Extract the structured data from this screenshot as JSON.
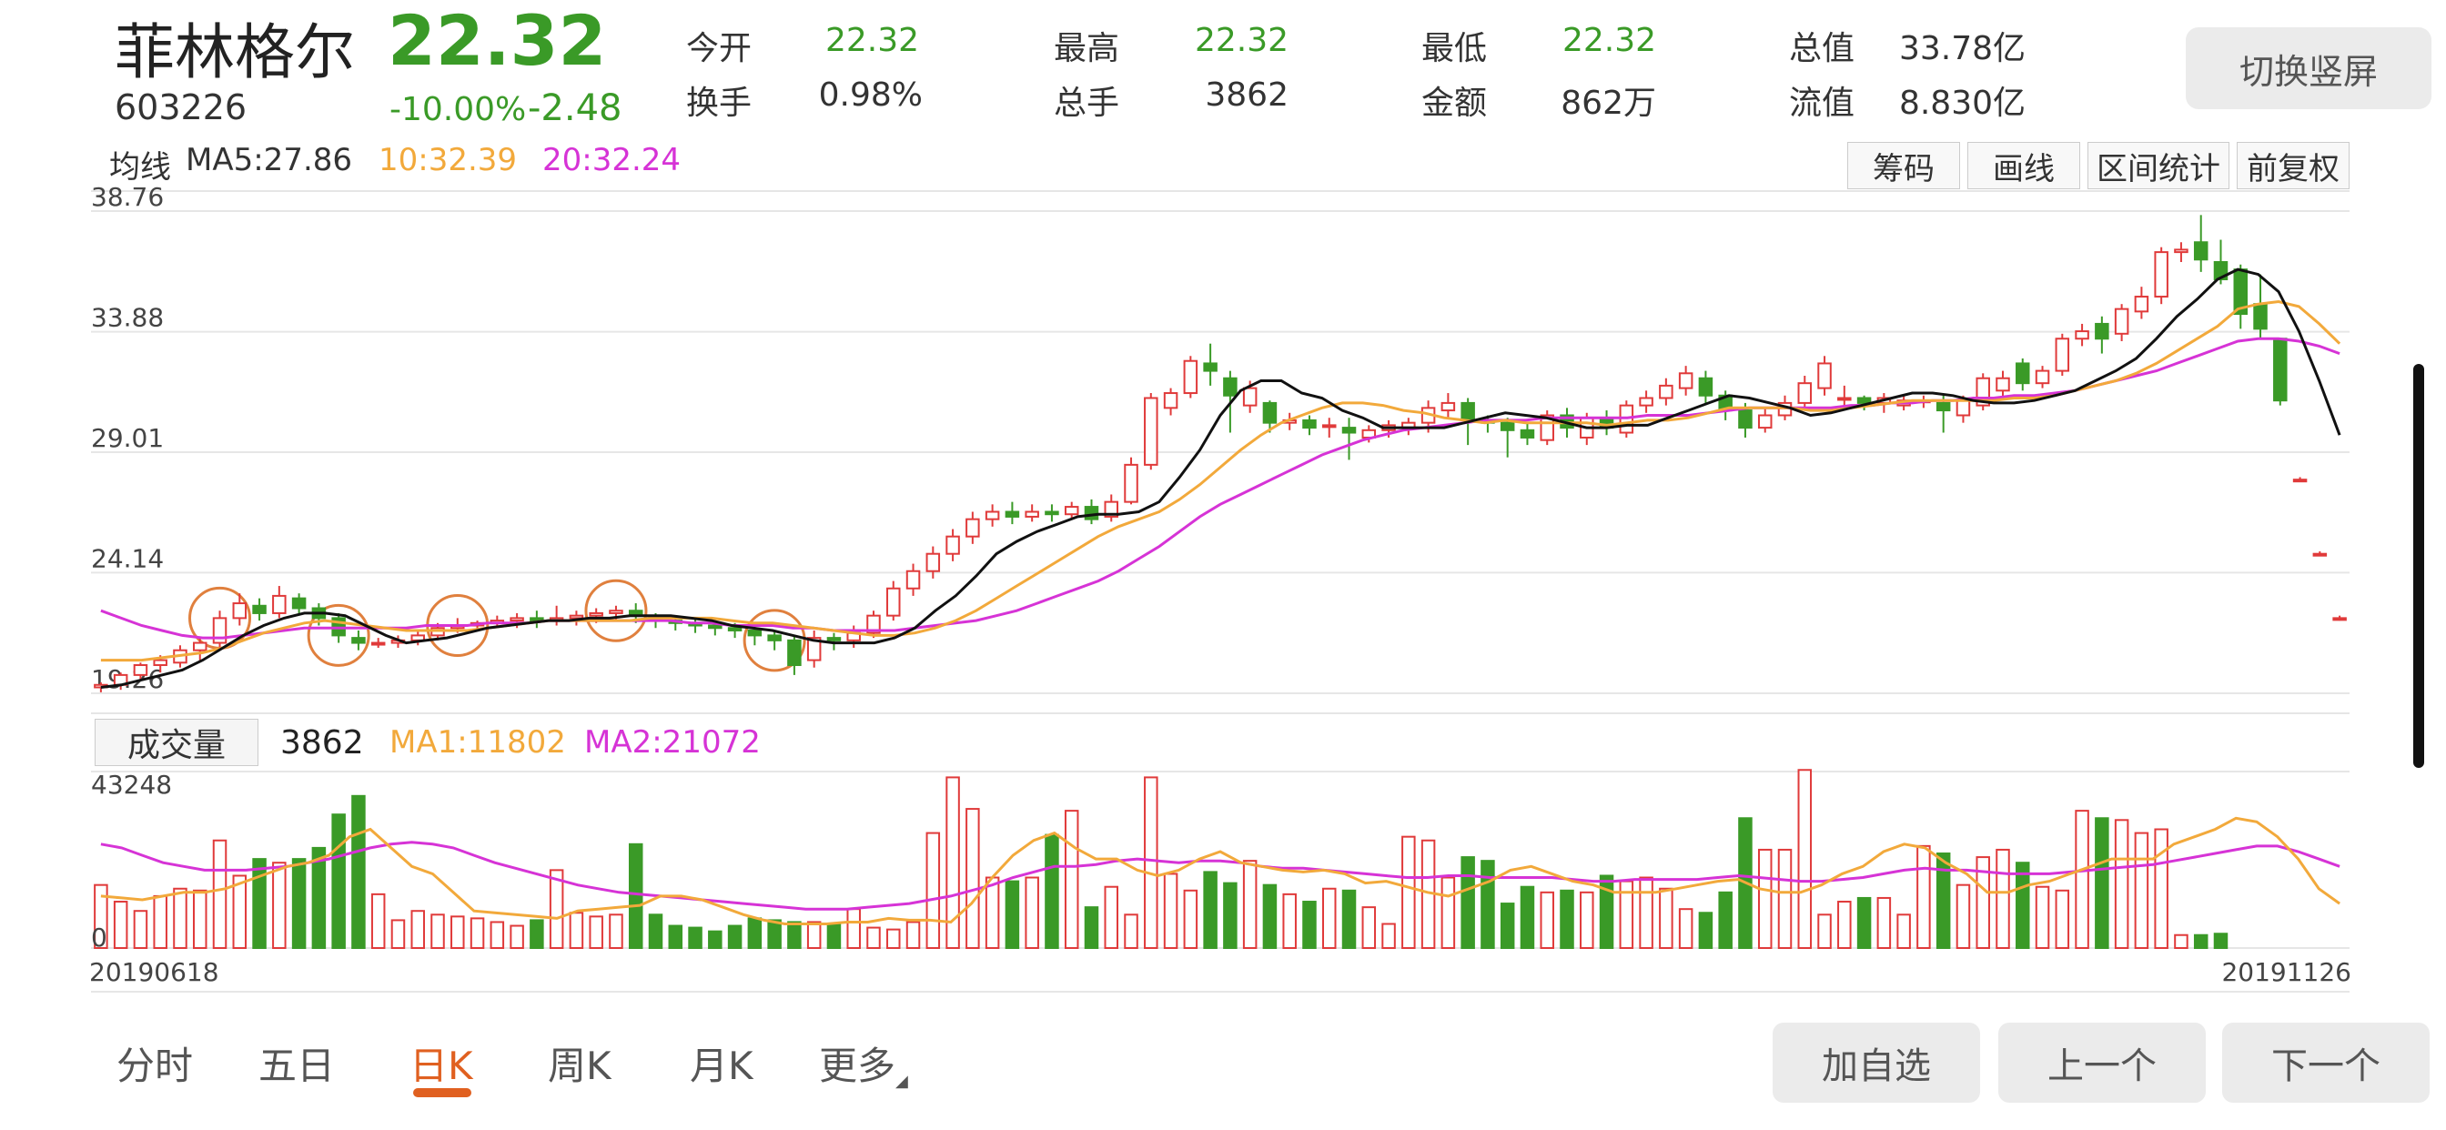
{
  "header": {
    "name": "菲林格尔",
    "price": "22.32",
    "code": "603226",
    "change_pct": "-10.00%",
    "change_amt": "-2.48",
    "quotes": [
      {
        "label": "今开",
        "value": "22.32",
        "color": "#3a9a27"
      },
      {
        "label": "最高",
        "value": "22.32",
        "color": "#3a9a27"
      },
      {
        "label": "最低",
        "value": "22.32",
        "color": "#3a9a27"
      },
      {
        "label": "总值",
        "value": "33.78亿",
        "color": "#333333"
      },
      {
        "label": "换手",
        "value": "0.98%",
        "color": "#333333"
      },
      {
        "label": "总手",
        "value": "3862",
        "color": "#333333"
      },
      {
        "label": "金额",
        "value": "862万",
        "color": "#333333"
      },
      {
        "label": "流值",
        "value": "8.830亿",
        "color": "#333333"
      }
    ],
    "switch_label": "切换竖屏"
  },
  "ma_bar": {
    "prefix": "均线",
    "ma5": "MA5:27.86",
    "ma10": "10:32.39",
    "ma20": "20:32.24"
  },
  "tools": [
    "筹码",
    "画线",
    "区间统计",
    "前复权"
  ],
  "volume_bar": {
    "label": "成交量",
    "value": "3862",
    "ma1": "MA1:11802",
    "ma2": "MA2:21072"
  },
  "bottom_tabs": [
    {
      "label": "分时",
      "active": false
    },
    {
      "label": "五日",
      "active": false
    },
    {
      "label": "日K",
      "active": true
    },
    {
      "label": "周K",
      "active": false
    },
    {
      "label": "月K",
      "active": false
    },
    {
      "label": "更多",
      "active": false
    }
  ],
  "bottom_buttons": [
    "加自选",
    "上一个",
    "下一个"
  ],
  "colors": {
    "up": "#e03a3a",
    "down": "#3a9a27",
    "ma5": "#111111",
    "ma10": "#f2a93b",
    "ma20": "#d633d6",
    "accent": "#e06020"
  },
  "chart_data": {
    "type": "candlestick",
    "x_start": "20190618",
    "x_end": "20191126",
    "y_ticks": [
      "38.76",
      "33.88",
      "29.01",
      "24.14",
      "19.26"
    ],
    "ylim": [
      19.26,
      38.76
    ],
    "volume_ymax": 43248,
    "volume_ticks": [
      "43248",
      "0"
    ],
    "candles": [
      [
        19.5,
        19.6,
        19.3,
        19.7
      ],
      [
        19.6,
        20.0,
        19.4,
        20.1
      ],
      [
        20.0,
        20.4,
        19.8,
        20.5
      ],
      [
        20.4,
        20.6,
        20.1,
        20.8
      ],
      [
        20.5,
        21.0,
        20.3,
        21.2
      ],
      [
        21.0,
        21.3,
        20.6,
        21.5
      ],
      [
        21.3,
        22.3,
        21.1,
        22.6
      ],
      [
        22.3,
        22.9,
        22.0,
        23.3
      ],
      [
        22.8,
        22.5,
        22.2,
        23.1
      ],
      [
        22.5,
        23.2,
        22.3,
        23.6
      ],
      [
        23.1,
        22.7,
        22.5,
        23.3
      ],
      [
        22.7,
        22.3,
        22.0,
        22.9
      ],
      [
        22.3,
        21.6,
        21.3,
        22.5
      ],
      [
        21.5,
        21.3,
        21.0,
        21.8
      ],
      [
        21.3,
        21.3,
        21.1,
        21.5
      ],
      [
        21.3,
        21.4,
        21.1,
        21.6
      ],
      [
        21.4,
        21.6,
        21.2,
        21.8
      ],
      [
        21.6,
        21.9,
        21.4,
        22.1
      ],
      [
        21.9,
        22.0,
        21.7,
        22.3
      ],
      [
        22.0,
        22.1,
        21.8,
        22.2
      ],
      [
        22.1,
        22.2,
        21.9,
        22.4
      ],
      [
        22.2,
        22.3,
        21.9,
        22.5
      ],
      [
        22.3,
        22.2,
        21.9,
        22.6
      ],
      [
        22.2,
        22.3,
        22.0,
        22.8
      ],
      [
        22.3,
        22.4,
        22.0,
        22.6
      ],
      [
        22.4,
        22.5,
        22.1,
        22.7
      ],
      [
        22.5,
        22.6,
        22.2,
        22.8
      ],
      [
        22.6,
        22.4,
        22.1,
        22.9
      ],
      [
        22.4,
        22.2,
        21.9,
        22.5
      ],
      [
        22.2,
        22.1,
        21.8,
        22.4
      ],
      [
        22.1,
        22.0,
        21.7,
        22.3
      ],
      [
        22.0,
        21.9,
        21.6,
        22.2
      ],
      [
        21.9,
        21.8,
        21.5,
        22.1
      ],
      [
        21.8,
        21.6,
        21.2,
        22.0
      ],
      [
        21.6,
        21.4,
        21.0,
        21.8
      ],
      [
        21.4,
        20.4,
        20.0,
        21.6
      ],
      [
        20.6,
        21.5,
        20.3,
        21.8
      ],
      [
        21.5,
        21.4,
        21.0,
        21.7
      ],
      [
        21.4,
        21.7,
        21.1,
        22.0
      ],
      [
        21.7,
        22.4,
        21.5,
        22.6
      ],
      [
        22.4,
        23.5,
        22.2,
        23.8
      ],
      [
        23.5,
        24.2,
        23.2,
        24.5
      ],
      [
        24.2,
        24.9,
        23.9,
        25.2
      ],
      [
        24.9,
        25.6,
        24.6,
        25.9
      ],
      [
        25.6,
        26.3,
        25.3,
        26.6
      ],
      [
        26.3,
        26.6,
        26.0,
        26.9
      ],
      [
        26.6,
        26.4,
        26.1,
        27.0
      ],
      [
        26.4,
        26.6,
        26.2,
        26.9
      ],
      [
        26.6,
        26.5,
        26.2,
        26.9
      ],
      [
        26.5,
        26.8,
        26.3,
        27.0
      ],
      [
        26.8,
        26.3,
        26.1,
        27.1
      ],
      [
        26.4,
        27.0,
        26.2,
        27.3
      ],
      [
        27.0,
        28.5,
        26.9,
        28.8
      ],
      [
        28.5,
        31.2,
        28.3,
        31.4
      ],
      [
        30.8,
        31.4,
        30.5,
        31.6
      ],
      [
        31.4,
        32.7,
        31.2,
        32.9
      ],
      [
        32.6,
        32.3,
        31.7,
        33.4
      ],
      [
        32.0,
        31.3,
        29.8,
        32.3
      ],
      [
        30.9,
        31.6,
        30.6,
        31.9
      ],
      [
        31.0,
        30.2,
        29.8,
        31.1
      ],
      [
        30.2,
        30.3,
        29.9,
        30.6
      ],
      [
        30.3,
        30.0,
        29.7,
        30.5
      ],
      [
        30.1,
        30.1,
        29.6,
        30.4
      ],
      [
        30.0,
        29.8,
        28.7,
        30.4
      ],
      [
        29.6,
        29.9,
        29.4,
        30.1
      ],
      [
        29.9,
        30.1,
        29.6,
        30.3
      ],
      [
        30.0,
        30.2,
        29.7,
        30.4
      ],
      [
        30.2,
        30.8,
        29.8,
        31.1
      ],
      [
        30.7,
        31.0,
        30.4,
        31.4
      ],
      [
        31.0,
        30.3,
        29.3,
        31.2
      ],
      [
        30.3,
        30.2,
        29.8,
        30.5
      ],
      [
        30.2,
        29.9,
        28.8,
        30.4
      ],
      [
        29.9,
        29.6,
        29.3,
        30.2
      ],
      [
        29.5,
        30.5,
        29.3,
        30.7
      ],
      [
        30.5,
        30.0,
        29.6,
        30.8
      ],
      [
        29.6,
        30.4,
        29.3,
        30.6
      ],
      [
        30.4,
        30.0,
        29.7,
        30.7
      ],
      [
        29.8,
        30.9,
        29.6,
        31.1
      ],
      [
        30.9,
        31.2,
        30.6,
        31.5
      ],
      [
        31.2,
        31.7,
        30.9,
        32.0
      ],
      [
        31.6,
        32.2,
        31.3,
        32.5
      ],
      [
        32.0,
        31.3,
        31.0,
        32.3
      ],
      [
        31.3,
        30.7,
        30.3,
        31.5
      ],
      [
        30.7,
        30.0,
        29.6,
        31.0
      ],
      [
        30.0,
        30.5,
        29.8,
        30.8
      ],
      [
        30.5,
        31.0,
        30.3,
        31.3
      ],
      [
        31.0,
        31.8,
        30.7,
        32.1
      ],
      [
        31.6,
        32.6,
        31.3,
        32.9
      ],
      [
        31.2,
        31.2,
        30.9,
        31.7
      ],
      [
        31.2,
        31.0,
        30.7,
        31.3
      ],
      [
        31.0,
        31.2,
        30.6,
        31.4
      ],
      [
        30.9,
        31.1,
        30.7,
        31.3
      ],
      [
        31.1,
        31.1,
        30.8,
        31.3
      ],
      [
        31.0,
        30.7,
        29.8,
        31.3
      ],
      [
        30.5,
        31.1,
        30.2,
        31.3
      ],
      [
        30.9,
        32.0,
        30.7,
        32.2
      ],
      [
        31.5,
        32.0,
        31.2,
        32.3
      ],
      [
        32.6,
        31.8,
        31.5,
        32.8
      ],
      [
        31.8,
        32.3,
        31.6,
        32.5
      ],
      [
        32.3,
        33.6,
        32.1,
        33.8
      ],
      [
        33.6,
        33.9,
        33.3,
        34.2
      ],
      [
        34.2,
        33.6,
        33.0,
        34.5
      ],
      [
        33.8,
        34.8,
        33.5,
        35.0
      ],
      [
        34.7,
        35.3,
        34.4,
        35.7
      ],
      [
        35.3,
        37.1,
        35.0,
        37.3
      ],
      [
        37.1,
        37.2,
        36.7,
        37.5
      ],
      [
        37.5,
        36.8,
        36.3,
        38.6
      ],
      [
        36.7,
        36.0,
        35.8,
        37.6
      ],
      [
        36.4,
        34.6,
        34.0,
        36.6
      ],
      [
        35.0,
        34.0,
        33.6,
        36.2
      ],
      [
        33.6,
        31.1,
        30.9,
        33.6
      ],
      [
        27.9,
        27.9,
        27.8,
        28.0
      ],
      [
        24.9,
        24.9,
        24.8,
        25.0
      ],
      [
        22.3,
        22.3,
        22.2,
        22.4
      ]
    ],
    "volumes": [
      17000,
      12500,
      10000,
      14000,
      16000,
      15500,
      29000,
      19500,
      24000,
      23000,
      24000,
      27000,
      36000,
      41000,
      14500,
      7500,
      10000,
      9000,
      8500,
      8000,
      7000,
      6000,
      7500,
      21000,
      9500,
      8500,
      9000,
      28000,
      9000,
      6000,
      5500,
      4500,
      6000,
      8000,
      7500,
      7000,
      7000,
      6500,
      10500,
      5500,
      5000,
      7000,
      31000,
      46000,
      37500,
      19000,
      18000,
      19000,
      30500,
      37000,
      11000,
      16500,
      9000,
      46000,
      20000,
      15500,
      20500,
      17500,
      23500,
      17000,
      14500,
      12500,
      16000,
      15500,
      11000,
      6500,
      30000,
      29000,
      19000,
      24500,
      23500,
      12000,
      16500,
      15000,
      15500,
      15000,
      19500,
      18000,
      19000,
      16000,
      10500,
      9500,
      15000,
      35000,
      26500,
      26500,
      48000,
      9000,
      12500,
      13500,
      13500,
      9000,
      27500,
      25500,
      17000,
      24500,
      26500,
      23000,
      16500,
      15500,
      37000,
      35000,
      34500,
      31000,
      32000,
      3500,
      3500,
      3862
    ],
    "ma5": [
      19.5,
      19.6,
      19.8,
      20.0,
      20.2,
      20.6,
      21.1,
      21.6,
      22.0,
      22.3,
      22.5,
      22.5,
      22.4,
      22.0,
      21.6,
      21.3,
      21.4,
      21.5,
      21.7,
      21.9,
      22.0,
      22.1,
      22.2,
      22.2,
      22.3,
      22.3,
      22.4,
      22.4,
      22.4,
      22.3,
      22.2,
      22.0,
      21.9,
      21.8,
      21.6,
      21.4,
      21.3,
      21.3,
      21.3,
      21.5,
      21.9,
      22.6,
      23.2,
      24.0,
      24.9,
      25.4,
      25.8,
      26.1,
      26.4,
      26.5,
      26.5,
      26.6,
      27.0,
      28.0,
      29.1,
      30.5,
      31.5,
      31.9,
      31.9,
      31.4,
      31.2,
      30.7,
      30.4,
      30.0,
      30.0,
      30.0,
      30.0,
      30.2,
      30.4,
      30.6,
      30.5,
      30.4,
      30.2,
      30.0,
      30.0,
      30.1,
      30.1,
      30.4,
      30.7,
      31.0,
      31.3,
      31.2,
      31.0,
      30.8,
      30.5,
      30.6,
      30.8,
      31.0,
      31.2,
      31.4,
      31.4,
      31.3,
      31.1,
      31.0,
      31.0,
      31.1,
      31.3,
      31.5,
      31.9,
      32.3,
      32.8,
      33.6,
      34.5,
      35.2,
      36.0,
      36.4,
      36.2,
      35.5,
      33.9,
      31.9,
      29.7
    ],
    "ma10": [
      20.6,
      20.6,
      20.6,
      20.7,
      20.8,
      20.9,
      21.1,
      21.4,
      21.7,
      21.9,
      22.1,
      22.2,
      22.1,
      22.0,
      21.9,
      21.8,
      21.8,
      21.8,
      21.8,
      21.9,
      22.0,
      22.1,
      22.2,
      22.2,
      22.2,
      22.2,
      22.2,
      22.3,
      22.3,
      22.3,
      22.3,
      22.2,
      22.1,
      22.1,
      22.0,
      21.9,
      21.8,
      21.7,
      21.6,
      21.6,
      21.7,
      21.9,
      22.2,
      22.6,
      23.1,
      23.6,
      24.1,
      24.6,
      25.1,
      25.6,
      26.0,
      26.3,
      26.6,
      27.1,
      27.7,
      28.4,
      29.1,
      29.7,
      30.2,
      30.5,
      30.8,
      31.0,
      31.0,
      30.9,
      30.7,
      30.6,
      30.4,
      30.3,
      30.2,
      30.3,
      30.2,
      30.2,
      30.2,
      30.2,
      30.1,
      30.2,
      30.3,
      30.3,
      30.4,
      30.6,
      30.8,
      30.8,
      30.8,
      30.8,
      30.7,
      30.7,
      30.8,
      30.9,
      31.0,
      31.1,
      31.1,
      31.1,
      31.1,
      31.1,
      31.2,
      31.2,
      31.3,
      31.5,
      31.7,
      31.9,
      32.2,
      32.6,
      33.1,
      33.6,
      34.1,
      34.8,
      35.0,
      35.1,
      34.9,
      34.2,
      33.4
    ],
    "ma20": [
      22.6,
      22.3,
      22.0,
      21.8,
      21.6,
      21.5,
      21.5,
      21.6,
      21.7,
      21.8,
      21.9,
      21.9,
      21.9,
      21.9,
      21.9,
      21.9,
      22.0,
      22.0,
      22.0,
      22.1,
      22.1,
      22.1,
      22.2,
      22.2,
      22.2,
      22.2,
      22.2,
      22.2,
      22.2,
      22.1,
      22.1,
      22.0,
      22.0,
      22.0,
      21.9,
      21.9,
      21.8,
      21.8,
      21.8,
      21.8,
      21.9,
      22.0,
      22.1,
      22.2,
      22.4,
      22.6,
      22.9,
      23.2,
      23.5,
      23.8,
      24.2,
      24.7,
      25.2,
      25.8,
      26.4,
      26.9,
      27.3,
      27.7,
      28.1,
      28.5,
      28.9,
      29.2,
      29.5,
      29.7,
      29.9,
      30.0,
      30.1,
      30.2,
      30.3,
      30.3,
      30.3,
      30.4,
      30.4,
      30.4,
      30.4,
      30.4,
      30.5,
      30.5,
      30.5,
      30.6,
      30.7,
      30.8,
      30.8,
      30.8,
      30.8,
      30.8,
      30.9,
      30.9,
      31.0,
      31.0,
      31.1,
      31.1,
      31.2,
      31.2,
      31.3,
      31.3,
      31.4,
      31.5,
      31.7,
      31.9,
      32.1,
      32.3,
      32.6,
      32.9,
      33.2,
      33.5,
      33.6,
      33.6,
      33.5,
      33.3,
      33.0
    ],
    "vol_ma1": [
      14000,
      13500,
      13000,
      14000,
      15000,
      15000,
      16000,
      18000,
      20000,
      22000,
      23000,
      25000,
      30000,
      32000,
      27000,
      22000,
      20000,
      15000,
      10000,
      9500,
      9000,
      8500,
      8000,
      10000,
      10500,
      11000,
      11500,
      14000,
      14000,
      13000,
      11000,
      9000,
      7500,
      6500,
      6500,
      6500,
      7000,
      7000,
      8000,
      7500,
      7500,
      7000,
      12000,
      19000,
      25000,
      29000,
      31000,
      27000,
      24000,
      24000,
      21000,
      19500,
      21000,
      24000,
      26000,
      23000,
      22000,
      21000,
      20500,
      21000,
      20000,
      17500,
      18000,
      16500,
      15000,
      14000,
      16000,
      18000,
      21000,
      22000,
      20000,
      18000,
      17000,
      15000,
      15000,
      15000,
      16000,
      17000,
      18000,
      18500,
      16000,
      15000,
      15000,
      17000,
      20000,
      22000,
      26000,
      28000,
      27000,
      23000,
      20000,
      15000,
      15000,
      17000,
      18000,
      20000,
      22000,
      24000,
      24000,
      24000,
      28000,
      30000,
      32000,
      35000,
      34000,
      30000,
      24000,
      16000,
      12000
    ],
    "vol_ma2": [
      28000,
      27000,
      25000,
      23000,
      22000,
      21000,
      21000,
      21000,
      21500,
      22000,
      23000,
      24000,
      25500,
      27000,
      28000,
      28500,
      28000,
      27000,
      25000,
      23000,
      21500,
      20000,
      18500,
      17000,
      16000,
      15000,
      14500,
      14000,
      13500,
      13000,
      12500,
      12000,
      11500,
      11000,
      10500,
      10500,
      10500,
      11000,
      11500,
      12000,
      13000,
      14000,
      15500,
      17000,
      19000,
      20500,
      22000,
      22000,
      22500,
      23500,
      24000,
      23500,
      23000,
      23500,
      23500,
      23000,
      22000,
      21500,
      21500,
      21000,
      20500,
      20000,
      19500,
      19000,
      19000,
      19500,
      19500,
      19000,
      19000,
      19000,
      19000,
      18500,
      18000,
      18000,
      18500,
      18500,
      18500,
      18500,
      19000,
      19500,
      19000,
      18500,
      18000,
      18000,
      18500,
      19000,
      20000,
      21000,
      21500,
      21000,
      21000,
      20500,
      20000,
      20000,
      20000,
      20500,
      21000,
      21500,
      22000,
      22500,
      23500,
      24500,
      25500,
      26500,
      27500,
      27500,
      26000,
      24000,
      22000
    ],
    "trade_markers": [
      3,
      6,
      9,
      13,
      17
    ]
  }
}
